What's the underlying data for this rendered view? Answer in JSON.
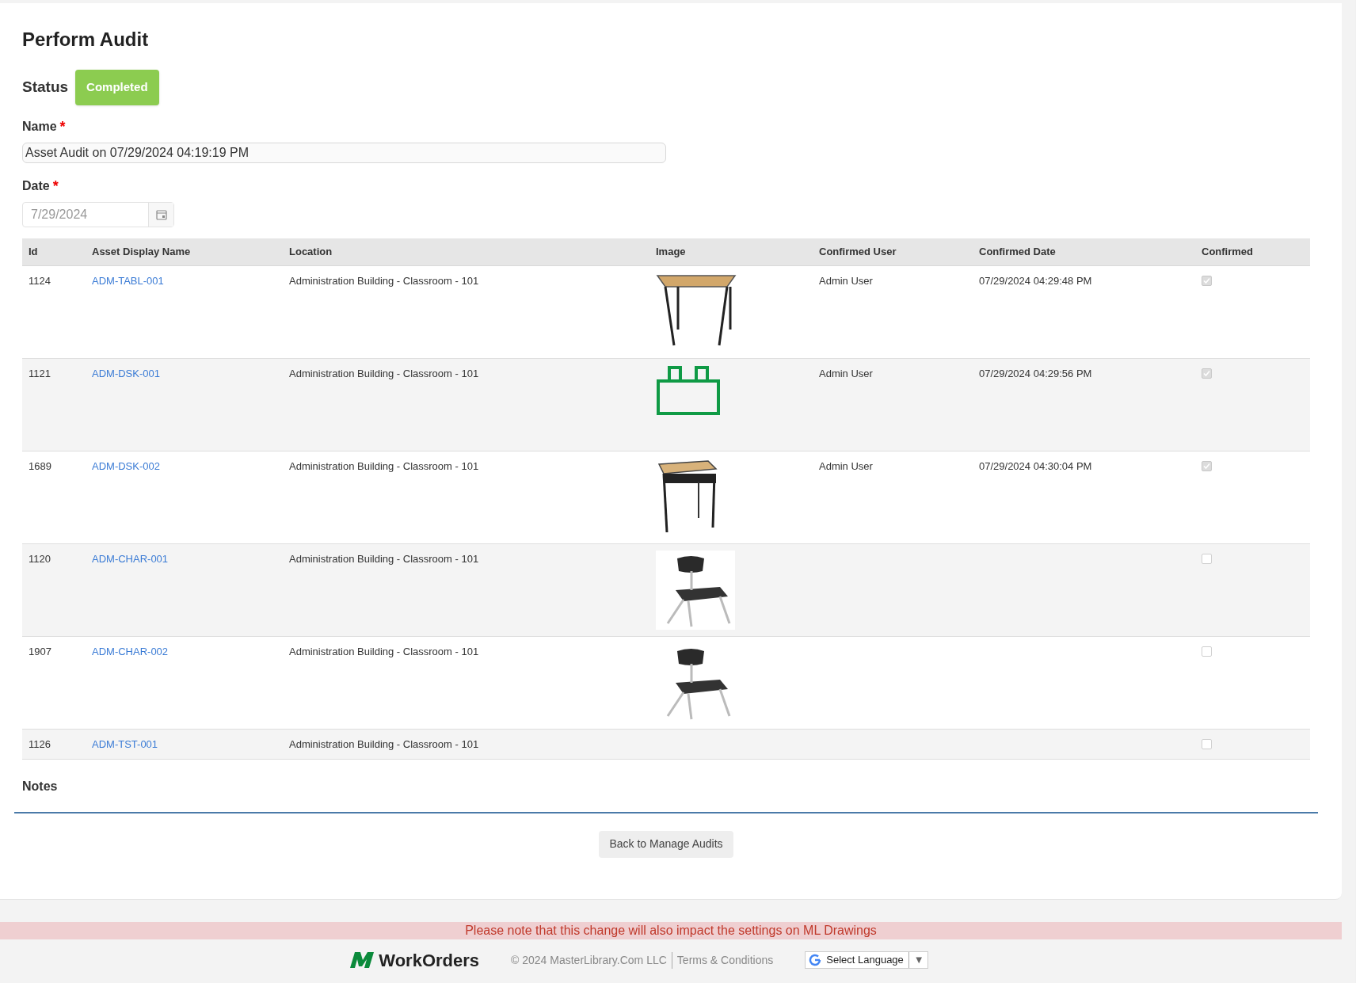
{
  "title": "Perform Audit",
  "status": {
    "label": "Status",
    "value": "Completed"
  },
  "name_field": {
    "label": "Name",
    "required_mark": "*",
    "value": "Asset Audit on 07/29/2024 04:19:19 PM"
  },
  "date_field": {
    "label": "Date",
    "required_mark": "*",
    "value": "7/29/2024",
    "disabled": true
  },
  "table": {
    "columns": [
      "Id",
      "Asset Display Name",
      "Location",
      "Image",
      "Confirmed User",
      "Confirmed Date",
      "Confirmed"
    ],
    "rows": [
      {
        "id": "1124",
        "asset": "ADM-TABL-001",
        "location": "Administration Building - Classroom - 101",
        "kind": "table",
        "user": "Admin User",
        "date": "07/29/2024 04:29:48 PM",
        "confirmed": true
      },
      {
        "id": "1121",
        "asset": "ADM-DSK-001",
        "location": "Administration Building - Classroom - 101",
        "kind": "icon",
        "user": "Admin User",
        "date": "07/29/2024 04:29:56 PM",
        "confirmed": true
      },
      {
        "id": "1689",
        "asset": "ADM-DSK-002",
        "location": "Administration Building - Classroom - 101",
        "kind": "desk",
        "user": "Admin User",
        "date": "07/29/2024 04:30:04 PM",
        "confirmed": true
      },
      {
        "id": "1120",
        "asset": "ADM-CHAR-001",
        "location": "Administration Building - Classroom - 101",
        "kind": "chair",
        "confirmed": false
      },
      {
        "id": "1907",
        "asset": "ADM-CHAR-002",
        "location": "Administration Building - Classroom - 101",
        "kind": "chair",
        "confirmed": false
      },
      {
        "id": "1126",
        "asset": "ADM-TST-001",
        "location": "Administration Building - Classroom - 101",
        "kind": "none",
        "confirmed": false
      }
    ]
  },
  "notes_label": "Notes",
  "back_button": "Back to Manage Audits",
  "notice": "Please note that this change will also impact the settings on ML Drawings",
  "footer": {
    "brand": "WorkOrders",
    "copyright": "© 2024 MasterLibrary.Com LLC",
    "terms": "Terms & Conditions",
    "language": "Select Language",
    "language_caret": "▼"
  }
}
